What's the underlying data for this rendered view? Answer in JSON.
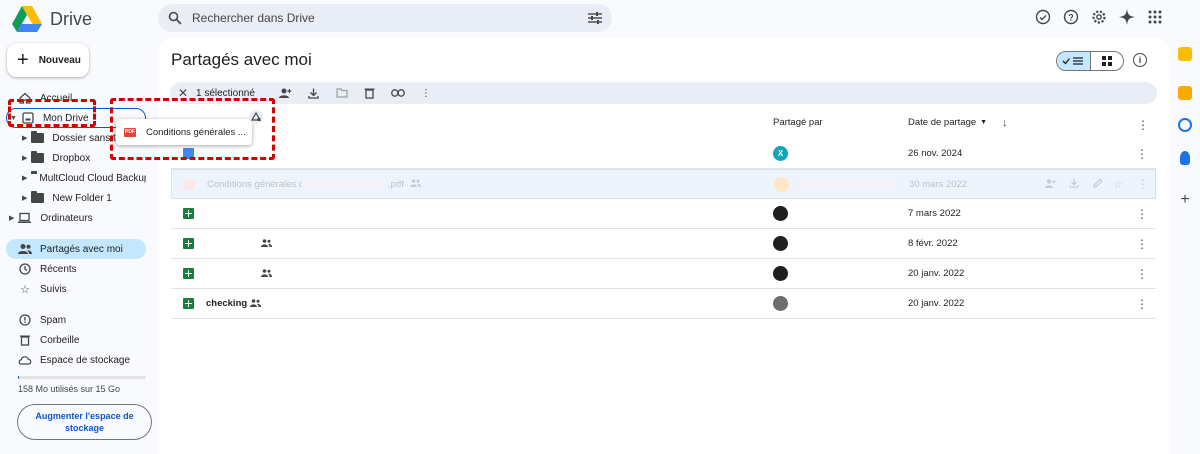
{
  "app": {
    "name": "Drive"
  },
  "search": {
    "placeholder": "Rechercher dans Drive"
  },
  "new_button": {
    "label": "Nouveau"
  },
  "sidebar": {
    "home": "Accueil",
    "my_drive": "Mon Drive",
    "folders": [
      "Dossier sans titre",
      "Dropbox",
      "MultCloud Cloud Backup",
      "New Folder 1"
    ],
    "computers": "Ordinateurs",
    "shared": "Partagés avec moi",
    "recent": "Récents",
    "starred": "Suivis",
    "spam": "Spam",
    "trash": "Corbeille",
    "storage": "Espace de stockage"
  },
  "storage": {
    "usage_text": "158 Mo utilisés sur 15 Go",
    "used_fraction": 0.01,
    "upgrade_label": "Augmenter l'espace de stockage"
  },
  "main": {
    "title": "Partagés avec moi"
  },
  "selection": {
    "count_label": "1 sélectionné"
  },
  "columns": {
    "shared_by": "Partagé par",
    "share_date": "Date de partage"
  },
  "drag_chip": {
    "label": "Conditions générales ..."
  },
  "rows": [
    {
      "type": "doc",
      "name": "",
      "avatar": "X",
      "date": "26 nov. 2024"
    },
    {
      "type": "pdf",
      "name": "Conditions générales d",
      "suffix": ".pdf",
      "avatar": "",
      "date": "30 mars 2022"
    },
    {
      "type": "sheet",
      "name": "",
      "avatar": "",
      "date": "7 mars 2022"
    },
    {
      "type": "sheet",
      "name": "",
      "avatar": "",
      "date": "8 févr. 2022"
    },
    {
      "type": "sheet",
      "name": "",
      "avatar": "",
      "date": "20 janv. 2022"
    },
    {
      "type": "sheet",
      "name": "checking",
      "avatar": "",
      "date": "20 janv. 2022"
    }
  ],
  "colors": {
    "accent": "#0b57d0",
    "active_nav": "#c2e7ff",
    "drag_outline": "#d40000"
  }
}
